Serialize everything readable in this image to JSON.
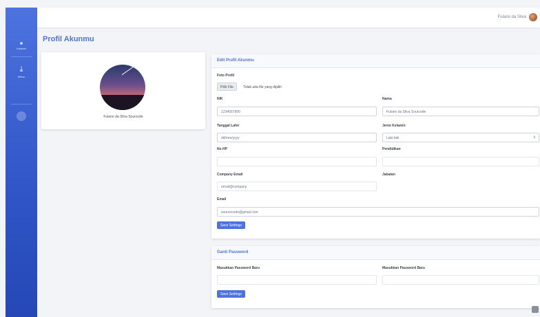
{
  "sidebar": {
    "brand_label": "Intranet",
    "items": [
      {
        "icon": "download-icon",
        "glyph": "⤓",
        "label": "Menu"
      }
    ]
  },
  "topbar": {
    "user_name": "Fulano da Silva"
  },
  "page": {
    "title": "Profil Akunmu"
  },
  "profile": {
    "caption": "Fulano da Silva Sourcode"
  },
  "profile_form": {
    "heading": "Edit Profil Akunmu",
    "photo_label": "Foto Profil",
    "file_button": "Pilih File",
    "file_name": "Tidak ada file yang dipilih",
    "nik_label": "NIK",
    "nik_value": "1234567890",
    "nama_label": "Nama",
    "nama_value": "Fulano da Silva Sourcode",
    "tgl_label": "Tanggal Lahir",
    "tgl_value": "dd/mm/yyyy",
    "gender_label": "Jenis Kelamin",
    "gender_value": "Laki-laki",
    "hp_label": "No HP",
    "hp_value": "",
    "pendidikan_label": "Pendidikan",
    "pendidikan_value": "",
    "company_email_label": "Company Email",
    "company_email_value": "email@company",
    "jabatan_label": "Jabatan",
    "email_label": "Email",
    "email_value": "sourcecode@gmail.com",
    "submit_label": "Save Settings"
  },
  "password_form": {
    "heading": "Ganti Password",
    "new_label": "Masukkan Password Baru",
    "confirm_label": "Masukkan Password Baru",
    "submit_label": "Save Settings"
  }
}
